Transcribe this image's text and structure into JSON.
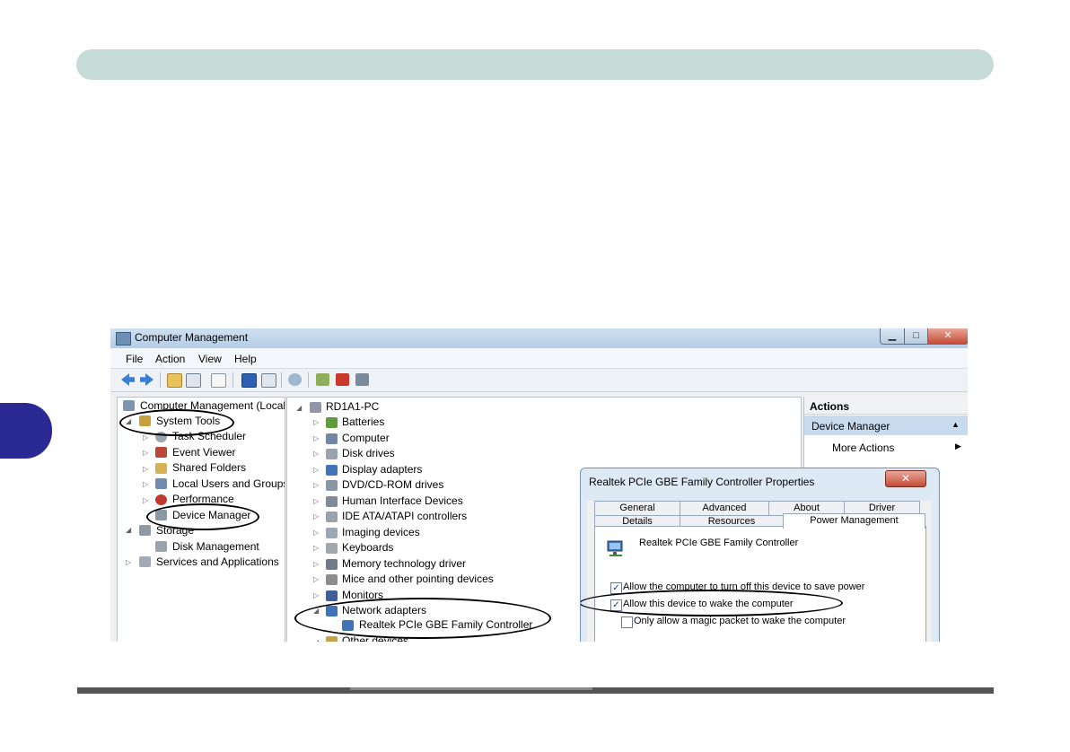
{
  "window": {
    "title": "Computer Management",
    "minimize_glyph": "▁",
    "maximize_glyph": "□",
    "close_glyph": "✕"
  },
  "menu": [
    "File",
    "Action",
    "View",
    "Help"
  ],
  "toolbar_icons": [
    "back-icon",
    "forward-icon",
    "up-folder-icon",
    "show-hide-tree-icon",
    "properties-icon",
    "help-icon",
    "show-hide-action-pane-icon",
    "scan-hardware-icon",
    "update-driver-icon",
    "uninstall-icon",
    "disable-icon"
  ],
  "left_tree": {
    "root": "Computer Management (Local",
    "system_tools": "System Tools",
    "task_scheduler": "Task Scheduler",
    "event_viewer": "Event Viewer",
    "shared_folders": "Shared Folders",
    "local_users": "Local Users and Groups",
    "performance": "Performance",
    "device_manager": "Device Manager",
    "storage": "Storage",
    "disk_management": "Disk Management",
    "services": "Services and Applications"
  },
  "device_tree": {
    "root": "RD1A1-PC",
    "items": [
      "Batteries",
      "Computer",
      "Disk drives",
      "Display adapters",
      "DVD/CD-ROM drives",
      "Human Interface Devices",
      "IDE ATA/ATAPI controllers",
      "Imaging devices",
      "Keyboards",
      "Memory technology driver",
      "Mice and other pointing devices",
      "Monitors",
      "Network adapters"
    ],
    "child": "Realtek PCIe GBE Family Controller",
    "last": "Other devices"
  },
  "actions": {
    "title": "Actions",
    "section": "Device Manager",
    "more": "More Actions"
  },
  "dialog": {
    "title": "Realtek PCIe GBE Family Controller Properties",
    "close_glyph": "✕",
    "tabs_back": [
      "General",
      "Advanced",
      "About",
      "Driver"
    ],
    "tabs_front": [
      "Details",
      "Resources"
    ],
    "active_tab": "Power Management",
    "device_name": "Realtek PCIe GBE Family Controller",
    "options": [
      {
        "label": "Allow the computer to turn off this device to save power",
        "checked": true
      },
      {
        "label": "Allow this device to wake the computer",
        "checked": true
      },
      {
        "label": "Only allow a magic packet to wake the computer",
        "checked": false
      }
    ]
  },
  "colors": {
    "header_band": "#c5dbd6",
    "chapter_tab": "#2b2a94",
    "selection": "#c8dbee"
  }
}
